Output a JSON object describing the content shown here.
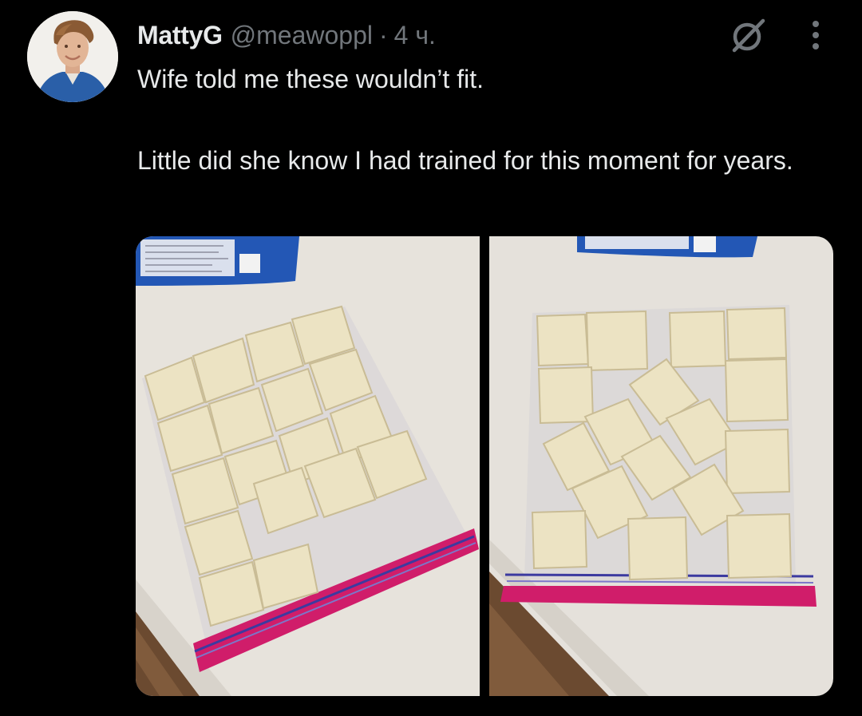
{
  "tweet": {
    "author": {
      "display_name": "MattyG",
      "handle": "@meawoppl",
      "avatar_icon": "profile-photo"
    },
    "separator": "·",
    "time": "4 ч.",
    "text_lines": [
      "Wife told me these wouldn’t fit.",
      "Little did she know I had trained for this moment for years."
    ],
    "actions": {
      "grok_icon": "grok-icon",
      "more_icon": "more-vertical-icon"
    },
    "media": [
      {
        "type": "photo",
        "depicts": "left-photo-icon"
      },
      {
        "type": "photo",
        "depicts": "right-photo-icon"
      }
    ]
  },
  "colors": {
    "background": "#000000",
    "primary_text": "#e7e9ea",
    "secondary_text": "#71767b"
  }
}
